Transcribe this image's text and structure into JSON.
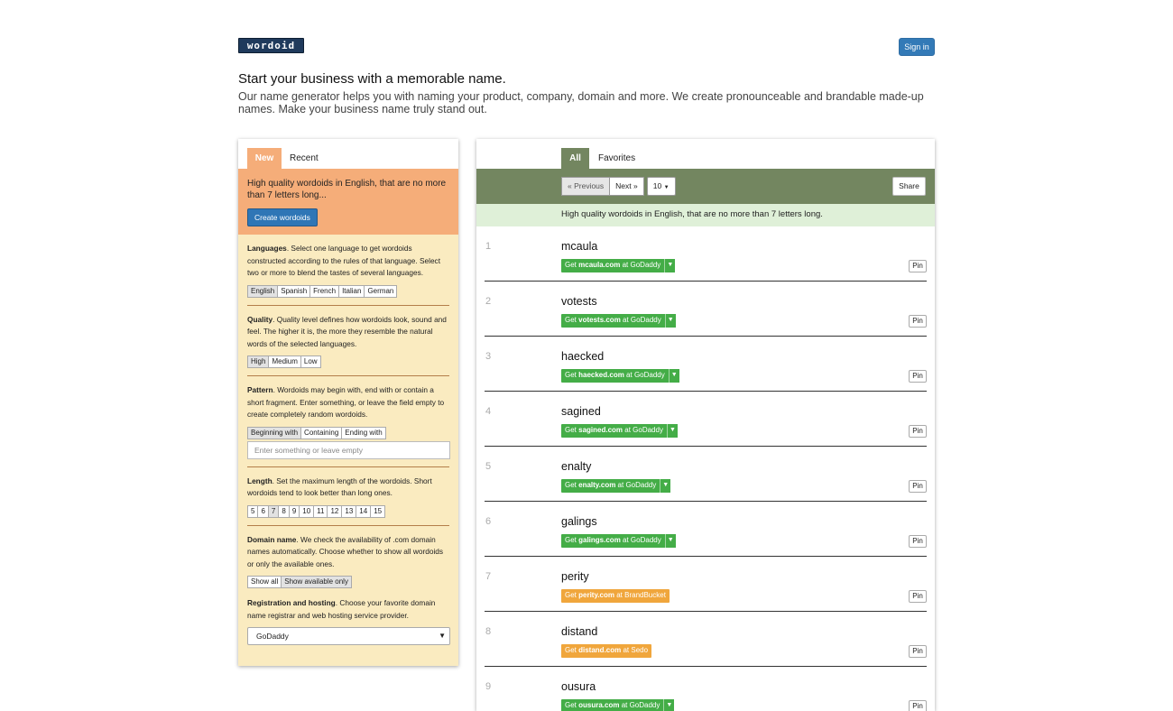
{
  "logo": "wordoid",
  "header": {
    "signin_label": "Sign in",
    "headline": "Start your business with a memorable name.",
    "subhead": "Our name generator helps you with naming your product, company, domain and more. We create pronounceable and brandable made-up names. Make your business name truly stand out."
  },
  "left": {
    "tabs": [
      "New",
      "Recent"
    ],
    "intro": "High quality wordoids in English, that are no more than 7 letters long...",
    "create_label": "Create wordoids",
    "languages": {
      "title": "Languages",
      "text": ". Select one language to get wordoids constructed according to the rules of that language. Select two or more to blend the tastes of several languages.",
      "options": [
        "English",
        "Spanish",
        "French",
        "Italian",
        "German"
      ]
    },
    "quality": {
      "title": "Quality",
      "text": ". Quality level defines how wordoids look, sound and feel. The higher it is, the more they resemble the natural words of the selected languages.",
      "options": [
        "High",
        "Medium",
        "Low"
      ]
    },
    "pattern": {
      "title": "Pattern",
      "text": ". Wordoids may begin with, end with or contain a short fragment. Enter something, or leave the field empty to create completely random wordoids.",
      "options": [
        "Beginning with",
        "Containing",
        "Ending with"
      ],
      "placeholder": "Enter something or leave empty"
    },
    "length": {
      "title": "Length",
      "text": ". Set the maximum length of the wordoids. Short wordoids tend to look better than long ones.",
      "options": [
        "5",
        "6",
        "7",
        "8",
        "9",
        "10",
        "11",
        "12",
        "13",
        "14",
        "15"
      ]
    },
    "domain": {
      "title": "Domain name",
      "text": ". We check the availability of .com domain names automatically. Choose whether to show all wordoids or only the available ones.",
      "options": [
        "Show all",
        "Show available only"
      ]
    },
    "registration": {
      "title": "Registration and hosting",
      "text": ". Choose your favorite domain name registrar and web hosting service provider.",
      "selected": "GoDaddy"
    }
  },
  "right": {
    "tabs": [
      "All",
      "Favorites"
    ],
    "prev_label": "« Previous",
    "next_label": "Next »",
    "count_label": "10",
    "share_label": "Share",
    "info": "High quality wordoids in English, that are no more than 7 letters long.",
    "pin_label": "Pin",
    "results": [
      {
        "num": "1",
        "word": "mcaula",
        "pre": "Get ",
        "domain": "mcaula.com",
        "post": " at GoDaddy"
      },
      {
        "num": "2",
        "word": "votests",
        "pre": "Get ",
        "domain": "votests.com",
        "post": " at GoDaddy"
      },
      {
        "num": "3",
        "word": "haecked",
        "pre": "Get ",
        "domain": "haecked.com",
        "post": " at GoDaddy"
      },
      {
        "num": "4",
        "word": "sagined",
        "pre": "Get ",
        "domain": "sagined.com",
        "post": " at GoDaddy"
      },
      {
        "num": "5",
        "word": "enalty",
        "pre": "Get ",
        "domain": "enalty.com",
        "post": " at GoDaddy"
      },
      {
        "num": "6",
        "word": "galings",
        "pre": "Get ",
        "domain": "galings.com",
        "post": " at GoDaddy"
      },
      {
        "num": "7",
        "word": "perity",
        "pre": "Get ",
        "domain": "perity.com",
        "post": " at BrandBucket"
      },
      {
        "num": "8",
        "word": "distand",
        "pre": "Get ",
        "domain": "distand.com",
        "post": " at Sedo"
      },
      {
        "num": "9",
        "word": "ousura",
        "pre": "Get ",
        "domain": "ousura.com",
        "post": " at GoDaddy"
      }
    ]
  },
  "colors": {
    "brand_blue": "#337ab7",
    "new_tab_orange": "#f5ad79",
    "left_bg": "#faebc0",
    "all_tab_green": "#738660",
    "info_green": "#dff0d8",
    "available_green": "#44ad47",
    "premium_orange": "#f0a63c"
  },
  "icons": [
    "caret-down-icon"
  ]
}
